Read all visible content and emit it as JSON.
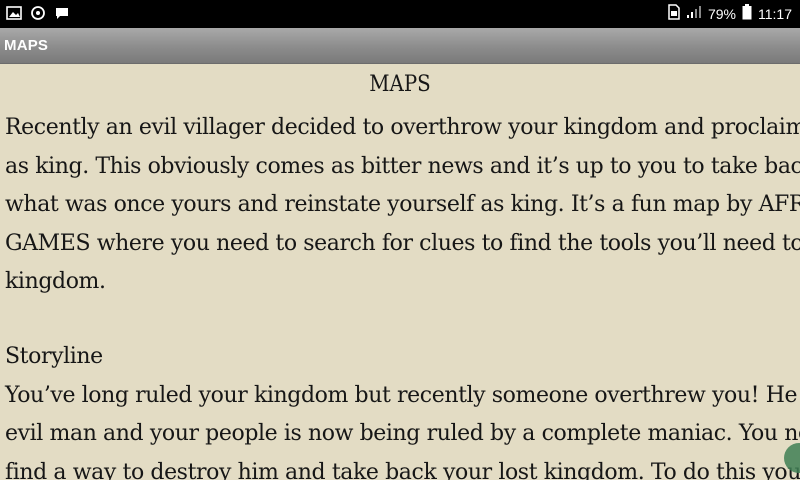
{
  "status_bar": {
    "left_icons": [
      "image-icon",
      "sync-icon",
      "chat-icon"
    ],
    "battery_percent": "79%",
    "time": "11:17"
  },
  "app_bar": {
    "title": "MAPS"
  },
  "article": {
    "heading": "MAPS",
    "paragraph1_lines": [
      "Recently an evil villager decided to overthrow your kingdom and proclaim himself",
      "as king. This obviously comes as bitter news and it’s up to you to take back",
      "what was once yours and reinstate yourself as king. It’s a fun map by AFRI-CAN",
      "GAMES where you need to search for clues to find the tools you’ll need to save the",
      "kingdom."
    ],
    "paragraph2_lines": [
      "Storyline",
      "You’ve long ruled your kingdom but recently someone overthrew you! He is an",
      "evil man and your people is now being ruled by a complete maniac. You need to",
      "find a way to destroy him and take back your lost kingdom. To do this you’ll need a"
    ]
  },
  "colors": {
    "background": "#e3dcc4",
    "app_bar": "#8c8c8c",
    "status_bar": "#000000"
  }
}
